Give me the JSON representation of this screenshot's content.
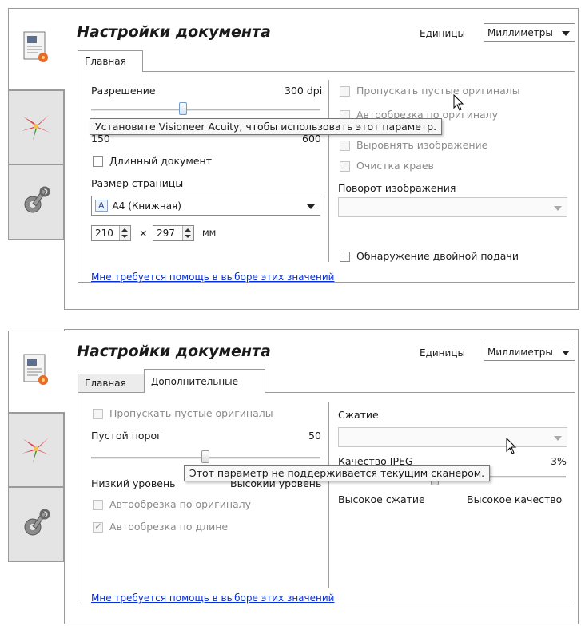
{
  "panel1": {
    "title": "Настройки документа",
    "units_label": "Единицы",
    "units_value": "Миллиметры",
    "tabs": [
      {
        "label": "Главная"
      }
    ],
    "resolution_label": "Разрешение",
    "resolution_value": "300 dpi",
    "slider_min": "150",
    "slider_max": "600",
    "tooltip": "Установите Visioneer Acuity, чтобы использовать этот параметр.",
    "long_document": "Длинный документ",
    "page_size_label": "Размер страницы",
    "page_size_value": "A4 (Книжная)",
    "page_size_icon": "A",
    "width_value": "210",
    "times": "×",
    "height_value": "297",
    "unit_mm": "мм",
    "skip_blank": "Пропускать пустые оригиналы",
    "autocrop": "Автообрезка по оригиналу",
    "straighten": "Выровнять изображение",
    "edge_clean": "Очистка краев",
    "rotation_label": "Поворот изображения",
    "double_feed": "Обнаружение двойной подачи",
    "help_link": "Мне требуется помощь в выборе этих значений"
  },
  "panel2": {
    "title": "Настройки документа",
    "units_label": "Единицы",
    "units_value": "Миллиметры",
    "tabs": [
      {
        "label": "Главная"
      },
      {
        "label": "Дополнительные"
      }
    ],
    "skip_blank": "Пропускать пустые оригиналы",
    "blank_threshold_label": "Пустой порог",
    "blank_threshold_value": "50",
    "low_level": "Низкий уровень",
    "high_level": "Высокий уровень",
    "autocrop": "Автообрезка по оригиналу",
    "autocrop_length": "Автообрезка по длине",
    "compression_label": "Сжатие",
    "jpeg_quality_label": "Качество JPEG",
    "jpeg_quality_value": "3%",
    "high_compression": "Высокое сжатие",
    "high_quality": "Высокое качество",
    "tooltip": "Этот параметр не поддерживается текущим сканером.",
    "help_link": "Мне требуется помощь в выборе этих значений"
  },
  "sidebar": {
    "items": [
      {
        "icon": "document-settings-icon"
      },
      {
        "icon": "flower-image-icon"
      },
      {
        "icon": "tools-gear-icon"
      }
    ]
  },
  "colors": {
    "link": "#0a2fd0",
    "thumb": "#6f9bd2"
  }
}
